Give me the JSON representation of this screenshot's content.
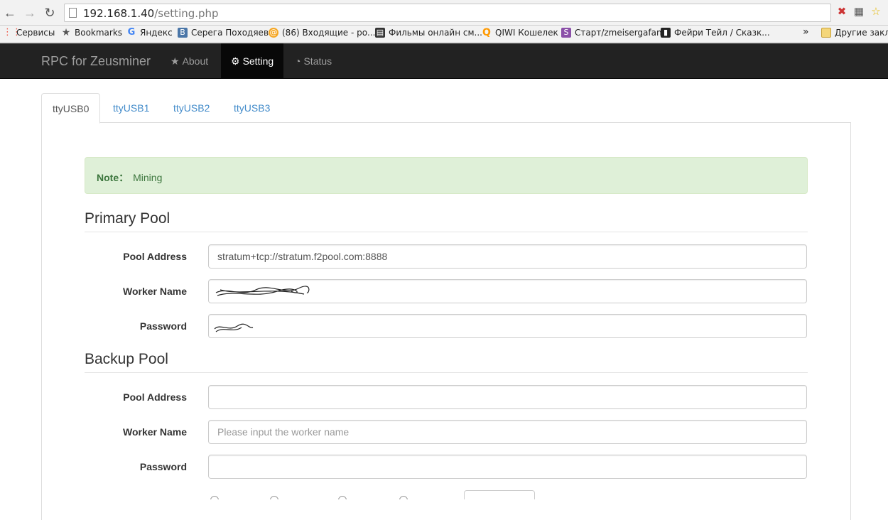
{
  "browser": {
    "url_host": "192.168.1.40",
    "url_path": "/setting.php",
    "bookmarks": [
      {
        "label": "Сервисы",
        "icon": "apps-grid-icon",
        "color": "#e54"
      },
      {
        "label": "Bookmarks",
        "icon": "star-icon",
        "color": "#555"
      },
      {
        "label": "Яндекс",
        "icon": "google-g-icon",
        "color": "#4285f4"
      },
      {
        "label": "Серега Походяев",
        "icon": "vk-icon",
        "color": "#4a76a8"
      },
      {
        "label": "(86) Входящие - ро...",
        "icon": "mail-at-icon",
        "color": "#f5a623"
      },
      {
        "label": "Фильмы онлайн см...",
        "icon": "clapper-icon",
        "color": "#333"
      },
      {
        "label": "QIWI Кошелек",
        "icon": "qiwi-icon",
        "color": "#f90"
      },
      {
        "label": "Старт/zmeisergafan",
        "icon": "s-icon",
        "color": "#8a4fa8"
      },
      {
        "label": "Фейри Тейл / Сказк...",
        "icon": "film-strip-icon",
        "color": "#222"
      },
      {
        "label": "»",
        "icon": "",
        "color": ""
      },
      {
        "label": "Другие закла",
        "icon": "folder-icon",
        "color": "#e8c160"
      }
    ]
  },
  "navbar": {
    "brand": "RPC for Zeusminer",
    "items": [
      {
        "label": "About",
        "icon": "star-icon",
        "active": false
      },
      {
        "label": "Setting",
        "icon": "gear-icon",
        "active": true
      },
      {
        "label": "Status",
        "icon": "dashboard-icon",
        "active": false
      }
    ]
  },
  "tabs": [
    "ttyUSB0",
    "ttyUSB1",
    "ttyUSB2",
    "ttyUSB3"
  ],
  "alert": {
    "label": "Note：",
    "text": "Mining"
  },
  "primary": {
    "title": "Primary Pool",
    "pool_label": "Pool Address",
    "pool_value": "stratum+tcp://stratum.f2pool.com:8888",
    "worker_label": "Worker Name",
    "password_label": "Password"
  },
  "backup": {
    "title": "Backup Pool",
    "pool_label": "Pool Address",
    "worker_label": "Worker Name",
    "worker_placeholder": "Please input the worker name",
    "password_label": "Password"
  },
  "colors": {
    "navbar": "#222222",
    "link": "#428bca",
    "alert_bg": "#dff0d8",
    "alert_text": "#3c763d"
  }
}
